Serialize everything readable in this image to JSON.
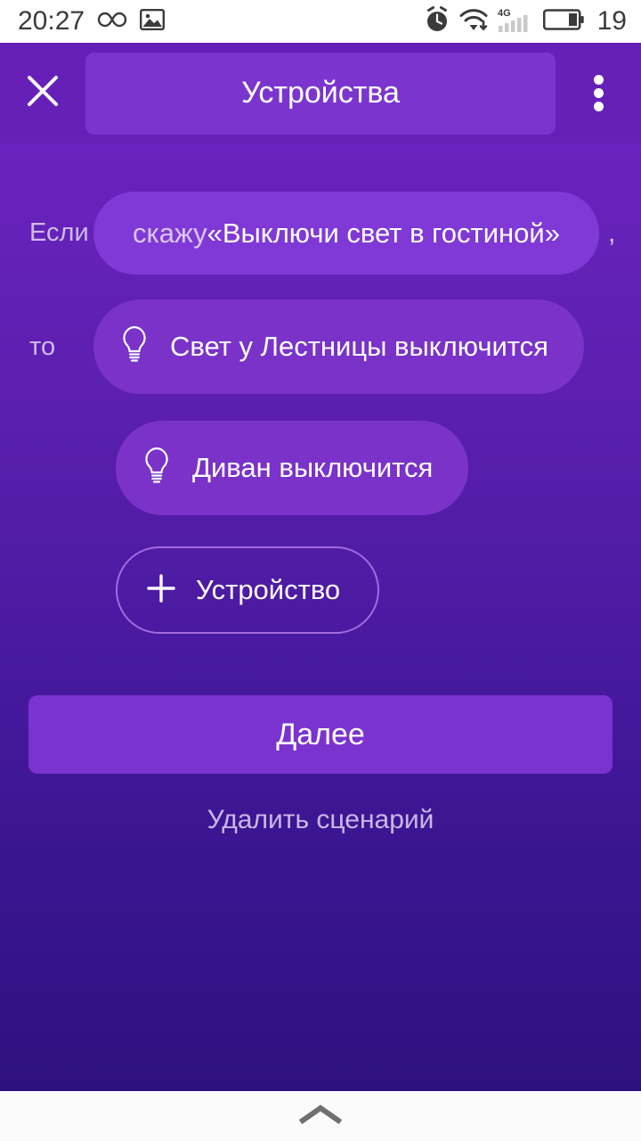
{
  "statusbar": {
    "time": "20:27",
    "battery_level": "19",
    "icons": [
      "infinity-icon",
      "image-icon",
      "alarm-icon",
      "wifi-icon",
      "signal-4g-icon",
      "battery-icon"
    ],
    "network_label": "4G"
  },
  "appbar": {
    "close_icon": "close-icon",
    "title": "Устройства",
    "menu_icon": "overflow-menu-icon"
  },
  "scenario": {
    "if_label": "Если",
    "then_label": "то",
    "trigger": {
      "prefix": "скажу ",
      "phrase": "«Выключи свет в гостиной»",
      "trailing_comma": ","
    },
    "devices": [
      {
        "icon": "lightbulb-icon",
        "label": "Свет у Лестницы выключится"
      },
      {
        "icon": "lightbulb-icon",
        "label": "Диван выключится"
      }
    ],
    "add_device": {
      "icon": "plus-icon",
      "label": "Устройство"
    }
  },
  "actions": {
    "next_label": "Далее",
    "delete_label": "Удалить сценарий"
  },
  "navbar": {
    "chevron_icon": "chevron-up-icon"
  },
  "colors": {
    "appbar": "#6620b8",
    "title_pill": "#7b35ce",
    "bg_top": "#6a23be",
    "bg_bottom": "#2e1180",
    "pill_if": "#8039d6",
    "pill_device": "#7a32c8",
    "primary_button": "#7a33ce",
    "outline_border": "#a569e0"
  }
}
